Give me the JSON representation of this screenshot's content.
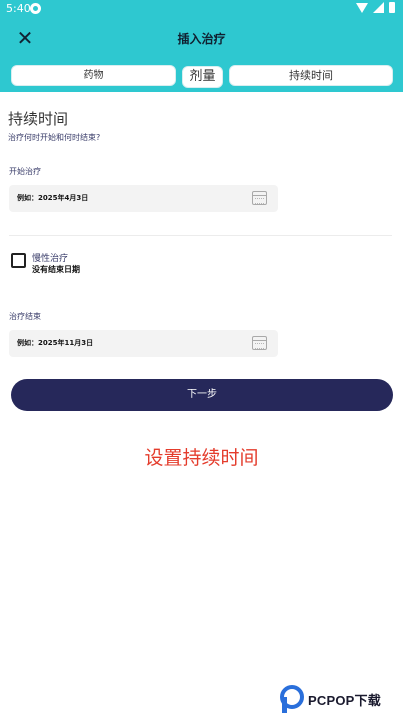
{
  "status_bar": {
    "time": "5:40"
  },
  "app_bar": {
    "title": "插入治疗",
    "close_icon": "close-icon"
  },
  "tabs": [
    {
      "label": "药物"
    },
    {
      "label": "剂量"
    },
    {
      "label": "持续时间"
    }
  ],
  "section": {
    "title": "持续时间",
    "subtitle": "治疗何时开始和何时结束?"
  },
  "start_field": {
    "label": "开始治疗",
    "placeholder": "例如：2025年4月3日",
    "icon": "calendar-icon"
  },
  "chronic": {
    "title": "慢性治疗",
    "subtitle": "没有结束日期",
    "checked": false
  },
  "end_field": {
    "label": "治疗结束",
    "placeholder": "例如：2025年11月3日",
    "icon": "calendar-icon"
  },
  "next_button": {
    "label": "下一步"
  },
  "overlay_caption": "设置持续时间",
  "watermark": {
    "text": "PCPOP下载"
  },
  "colors": {
    "header": "#2ec8d0",
    "button": "#26285a",
    "caption": "#e43c2c"
  }
}
